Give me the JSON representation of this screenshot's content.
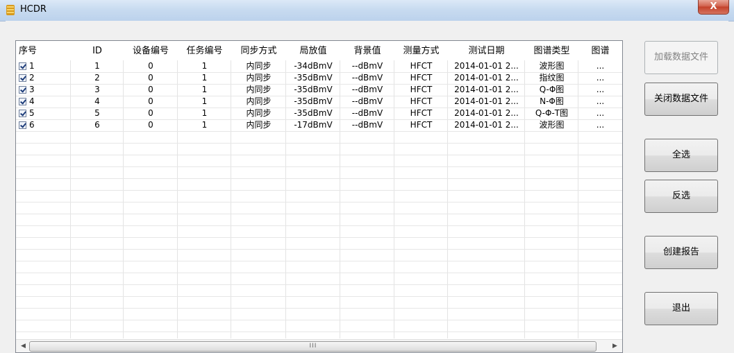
{
  "window": {
    "title": "HCDR",
    "close_glyph": "X"
  },
  "table": {
    "headers": [
      "序号",
      "ID",
      "设备编号",
      "任务编号",
      "同步方式",
      "局放值",
      "背景值",
      "测量方式",
      "测试日期",
      "图谱类型",
      "图谱"
    ],
    "rows": [
      {
        "checked": true,
        "cells": [
          "1",
          "1",
          "0",
          "1",
          "内同步",
          "-34dBmV",
          "--dBmV",
          "HFCT",
          "2014-01-01 2...",
          "波形图",
          "..."
        ]
      },
      {
        "checked": true,
        "cells": [
          "2",
          "2",
          "0",
          "1",
          "内同步",
          "-35dBmV",
          "--dBmV",
          "HFCT",
          "2014-01-01 2...",
          "指纹图",
          "..."
        ]
      },
      {
        "checked": true,
        "cells": [
          "3",
          "3",
          "0",
          "1",
          "内同步",
          "-35dBmV",
          "--dBmV",
          "HFCT",
          "2014-01-01 2...",
          "Q-Φ图",
          "..."
        ]
      },
      {
        "checked": true,
        "cells": [
          "4",
          "4",
          "0",
          "1",
          "内同步",
          "-35dBmV",
          "--dBmV",
          "HFCT",
          "2014-01-01 2...",
          "N-Φ图",
          "..."
        ]
      },
      {
        "checked": true,
        "cells": [
          "5",
          "5",
          "0",
          "1",
          "内同步",
          "-35dBmV",
          "--dBmV",
          "HFCT",
          "2014-01-01 2...",
          "Q-Φ-T图",
          "..."
        ]
      },
      {
        "checked": true,
        "cells": [
          "6",
          "6",
          "0",
          "1",
          "内同步",
          "-17dBmV",
          "--dBmV",
          "HFCT",
          "2014-01-01 2...",
          "波形图",
          "..."
        ]
      }
    ],
    "scroll_left": "◀",
    "scroll_right": "▶",
    "scroll_grip": "III"
  },
  "buttons": {
    "load_file": {
      "label": "加载数据文件",
      "enabled": false
    },
    "close_file": {
      "label": "关闭数据文件",
      "enabled": true
    },
    "select_all": {
      "label": "全选",
      "enabled": true
    },
    "invert_select": {
      "label": "反选",
      "enabled": true
    },
    "create_report": {
      "label": "创建报告",
      "enabled": true
    },
    "exit": {
      "label": "退出",
      "enabled": true
    }
  },
  "colors": {
    "title_bar": "#c8dbf0",
    "close_button": "#c4412a",
    "window_bg": "#f0f0f0",
    "grid_bg": "#ffffff"
  },
  "icons": {
    "app": "database-icon",
    "checkbox": "checkbox-checked-icon"
  }
}
